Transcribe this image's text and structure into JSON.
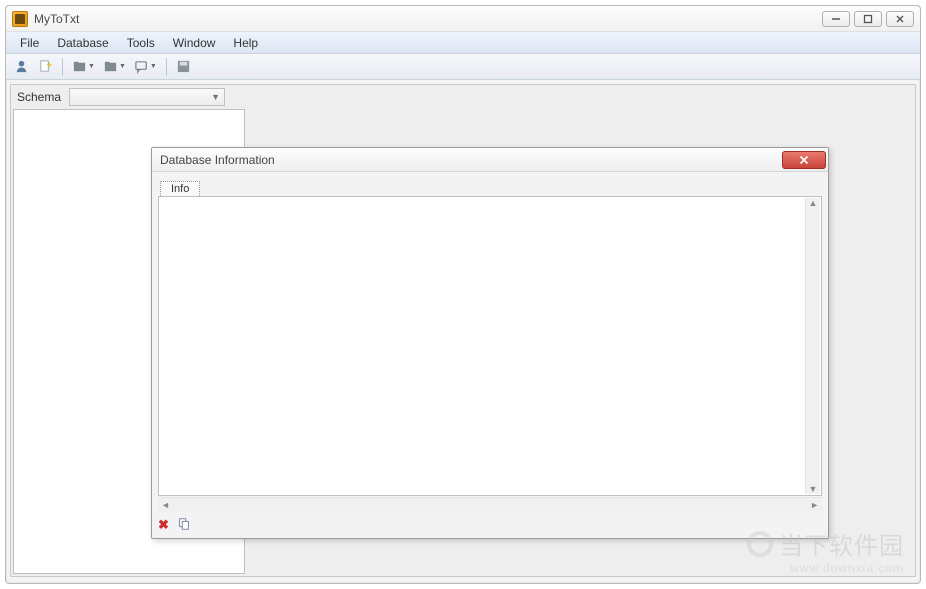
{
  "app": {
    "title": "MyToTxt"
  },
  "menu": {
    "items": [
      "File",
      "Database",
      "Tools",
      "Window",
      "Help"
    ]
  },
  "sidebar": {
    "schema_label": "Schema",
    "schema_value": ""
  },
  "dialog": {
    "title": "Database Information",
    "tabs": [
      {
        "label": "Info"
      }
    ],
    "content": ""
  },
  "watermark": {
    "line1": "当下软件园",
    "line2": "www.downxia.com"
  }
}
